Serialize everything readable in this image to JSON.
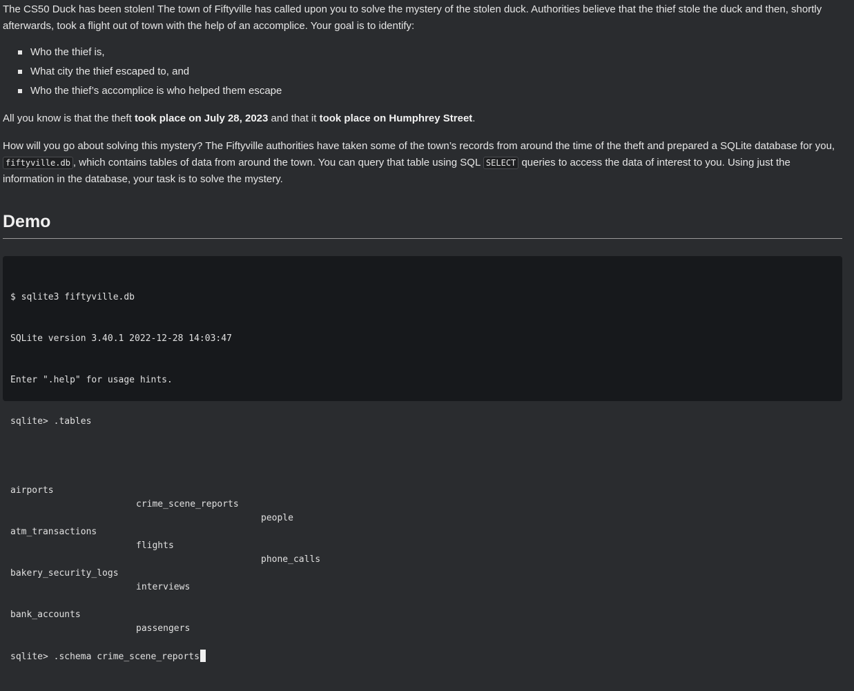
{
  "intro": {
    "text": "The CS50 Duck has been stolen! The town of Fiftyville has called upon you to solve the mystery of the stolen duck. Authorities believe that the thief stole the duck and then, shortly afterwards, took a flight out of town with the help of an accomplice. Your goal is to identify:"
  },
  "goals": [
    "Who the thief is,",
    "What city the thief escaped to, and",
    "Who the thief’s accomplice is who helped them escape"
  ],
  "known": {
    "prefix": "All you know is that the theft ",
    "bold1": "took place on July 28, 2023",
    "middle": " and that it ",
    "bold2": "took place on Humphrey Street",
    "suffix": "."
  },
  "how": {
    "part1": "How will you go about solving this mystery? The Fiftyville authorities have taken some of the town’s records from around the time of the theft and prepared a SQLite database for you, ",
    "code1": "fiftyville.db",
    "part2": ", which contains tables of data from around the town. You can query that table using SQL ",
    "code2": "SELECT",
    "part3": " queries to access the data of interest to you. Using just the information in the database, your task is to solve the mystery."
  },
  "demo": {
    "heading": "Demo"
  },
  "terminal": {
    "lines": [
      "$ sqlite3 fiftyville.db",
      "SQLite version 3.40.1 2022-12-28 14:03:47",
      "Enter \".help\" for usage hints.",
      "sqlite> .tables"
    ],
    "tables": [
      [
        "airports",
        "crime_scene_reports",
        "people"
      ],
      [
        "atm_transactions",
        "flights",
        "phone_calls"
      ],
      [
        "bakery_security_logs",
        "interviews",
        ""
      ],
      [
        "bank_accounts",
        "passengers",
        ""
      ]
    ],
    "last_line": "sqlite> .schema crime_scene_reports"
  }
}
